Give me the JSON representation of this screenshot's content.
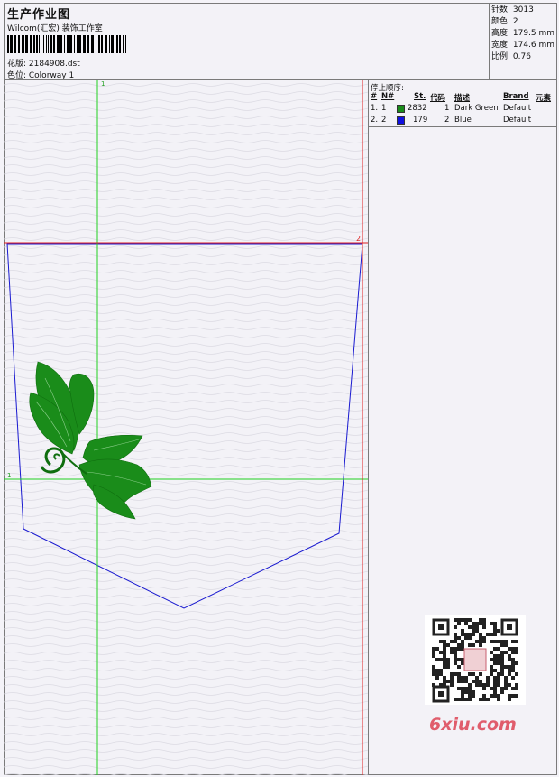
{
  "header": {
    "title": "生产作业图",
    "company": "Wilcom(汇宏) 装饰工作室",
    "design_label": "花版: 2184908.dst",
    "color_label": "色位: Colorway 1"
  },
  "stats": {
    "stitches": "针数: 3013",
    "colors": "颜色: 2",
    "height": "高度: 179.5 mm",
    "width": "宽度: 174.6 mm",
    "scale": "比例: 0.76"
  },
  "stop_sequence": {
    "title": "停止顺序:",
    "columns": [
      "#",
      "N#",
      "St.",
      "代码",
      "描述",
      "Brand",
      "元素"
    ],
    "rows": [
      {
        "idx": "1.",
        "n": "1",
        "swatch": "#1a8c1a",
        "st": "2832",
        "code": "1",
        "desc": "Dark Green",
        "brand": "Default"
      },
      {
        "idx": "2.",
        "n": "2",
        "swatch": "#1010e0",
        "st": "179",
        "code": "2",
        "desc": "Blue",
        "brand": "Default"
      }
    ]
  },
  "guides": {
    "green_vertical_label": "1",
    "green_horizontal_label": "1",
    "red_corner_label": "2",
    "colors": {
      "green": "#22d022",
      "red": "#e02020",
      "blue": "#1a1ad0",
      "leaf": "#1a8c1a"
    }
  },
  "watermark": {
    "text": "6xiu.com",
    "color": "#e05d6c"
  }
}
